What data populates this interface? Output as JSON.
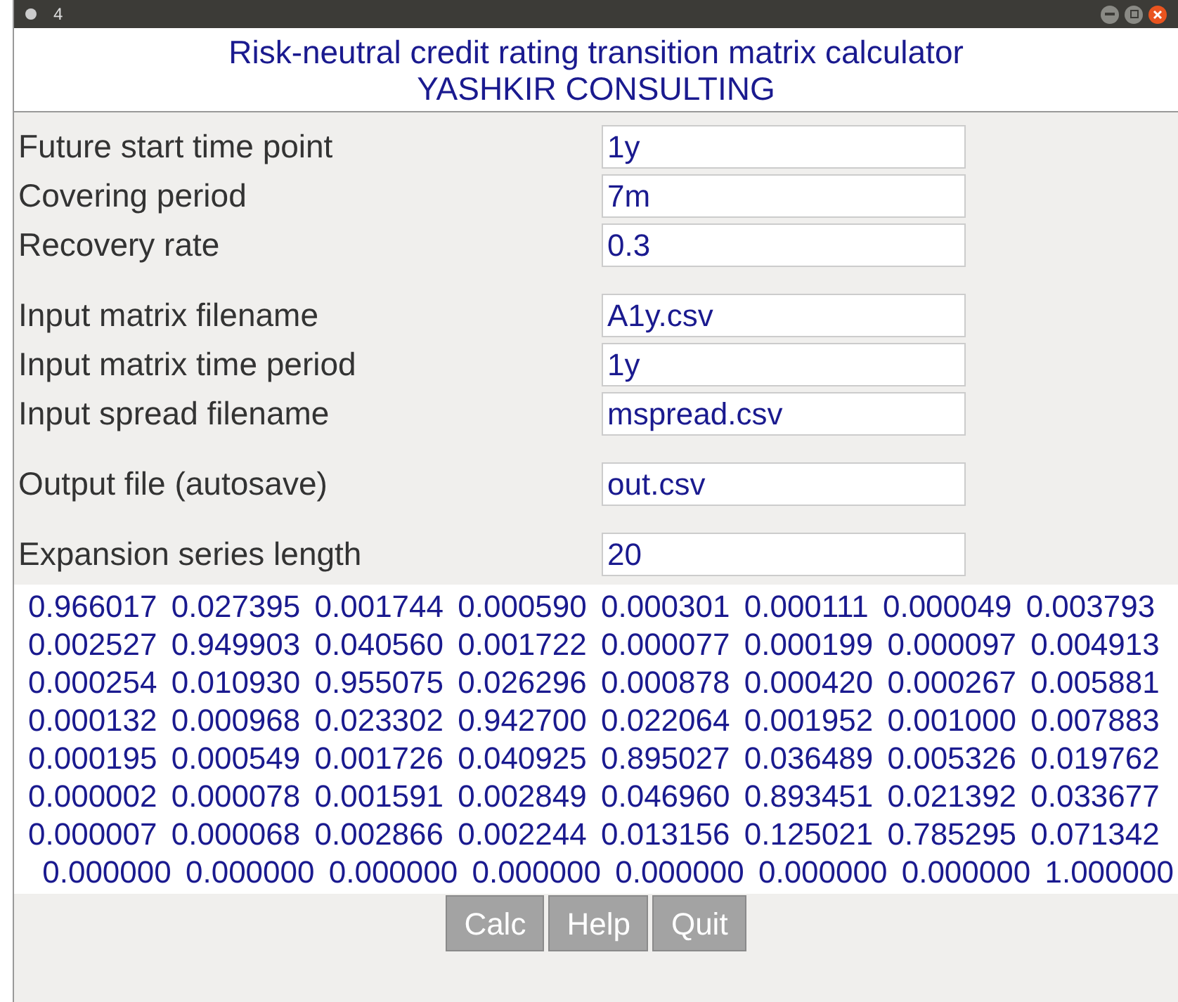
{
  "window": {
    "title": "4"
  },
  "header": {
    "title": "Risk-neutral credit rating transition matrix calculator",
    "subtitle": "YASHKIR CONSULTING"
  },
  "groups": [
    {
      "fields": [
        {
          "label": "Future start time point",
          "value": "1y"
        },
        {
          "label": "Covering period",
          "value": "7m"
        },
        {
          "label": "Recovery rate",
          "value": "0.3"
        }
      ]
    },
    {
      "fields": [
        {
          "label": "Input matrix filename",
          "value": "A1y.csv"
        },
        {
          "label": "Input matrix time period",
          "value": "1y"
        },
        {
          "label": "Input spread filename",
          "value": "mspread.csv"
        }
      ]
    },
    {
      "fields": [
        {
          "label": "Output file (autosave)",
          "value": "out.csv"
        }
      ]
    },
    {
      "fields": [
        {
          "label": "Expansion series length",
          "value": "20"
        }
      ]
    }
  ],
  "matrix": [
    "0.966017 0.027395 0.001744 0.000590 0.000301 0.000111 0.000049 0.003793",
    "0.002527 0.949903 0.040560 0.001722 0.000077 0.000199 0.000097 0.004913",
    "0.000254 0.010930 0.955075 0.026296 0.000878 0.000420 0.000267 0.005881",
    "0.000132 0.000968 0.023302 0.942700 0.022064 0.001952 0.001000 0.007883",
    "0.000195 0.000549 0.001726 0.040925 0.895027 0.036489 0.005326 0.019762",
    "0.000002 0.000078 0.001591 0.002849 0.046960 0.893451 0.021392 0.033677",
    "0.000007 0.000068 0.002866 0.002244 0.013156 0.125021 0.785295 0.071342",
    " 0.000000 0.000000 0.000000 0.000000 0.000000 0.000000 0.000000 1.000000"
  ],
  "buttons": [
    "Calc",
    "Help",
    "Quit"
  ]
}
